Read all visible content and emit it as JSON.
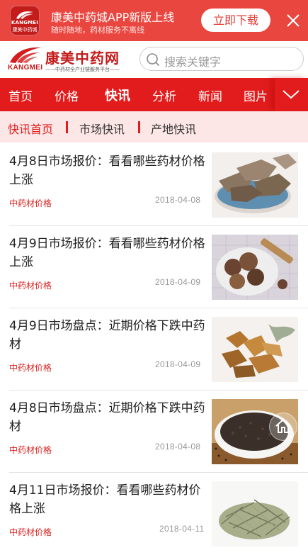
{
  "banner": {
    "icon_line1": "KANGMEI",
    "icon_line2": "康美中药城",
    "title": "康美中药城APP新版上线",
    "subtitle": "随时随地，药材服务不离线",
    "download_label": "立即下载",
    "close_icon": "close-icon"
  },
  "header": {
    "logo_cn": "康美中药网",
    "logo_en": "KANGMEI",
    "logo_tagline": "——中药材全产业链服务平台——",
    "search_placeholder": "搜索关键字"
  },
  "nav": {
    "items": [
      "首页",
      "价格",
      "快讯",
      "分析",
      "新闻",
      "图片"
    ],
    "active": "快讯",
    "more_icon": "chevron-down-icon"
  },
  "subnav": {
    "items": [
      "快讯首页",
      "市场快讯",
      "产地快讯"
    ],
    "active": "快讯首页"
  },
  "articles": [
    {
      "title": "4月8日市场报价：看看哪些药材价格上涨",
      "category": "中药材价格",
      "date": "2018-04-08"
    },
    {
      "title": "4月9日市场报价：看看哪些药材价格上涨",
      "category": "中药材价格",
      "date": "2018-04-09"
    },
    {
      "title": "4月9日市场盘点：近期价格下跌中药材",
      "category": "中药材价格",
      "date": "2018-04-09"
    },
    {
      "title": "4月8日市场盘点：近期价格下跌中药材",
      "category": "中药材价格",
      "date": "2018-04-08"
    },
    {
      "title": "4月11日市场报价：看看哪些药材价格上涨",
      "category": "中药材价格",
      "date": "2018-04-11"
    }
  ],
  "colors": {
    "brand_red": "#e21c1c",
    "banner_red": "#e9463f",
    "subnav_bg": "#fde6e6"
  }
}
